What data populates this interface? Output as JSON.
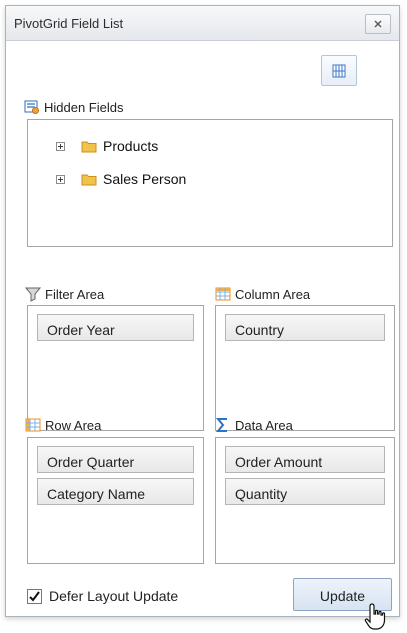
{
  "window": {
    "title": "PivotGrid Field List"
  },
  "hidden_fields": {
    "label": "Hidden Fields",
    "items": [
      "Products",
      "Sales Person"
    ]
  },
  "areas": {
    "filter": {
      "label": "Filter Area",
      "fields": [
        "Order Year"
      ]
    },
    "column": {
      "label": "Column Area",
      "fields": [
        "Country"
      ]
    },
    "row": {
      "label": "Row Area",
      "fields": [
        "Order Quarter",
        "Category Name"
      ]
    },
    "data": {
      "label": "Data Area",
      "fields": [
        "Order Amount",
        "Quantity"
      ]
    }
  },
  "footer": {
    "defer_label": "Defer Layout Update",
    "defer_checked": true,
    "update_label": "Update"
  },
  "colors": {
    "accent_blue": "#2d73c5",
    "folder_yellow": "#f2c34b",
    "grid_orange": "#f19a2a"
  }
}
